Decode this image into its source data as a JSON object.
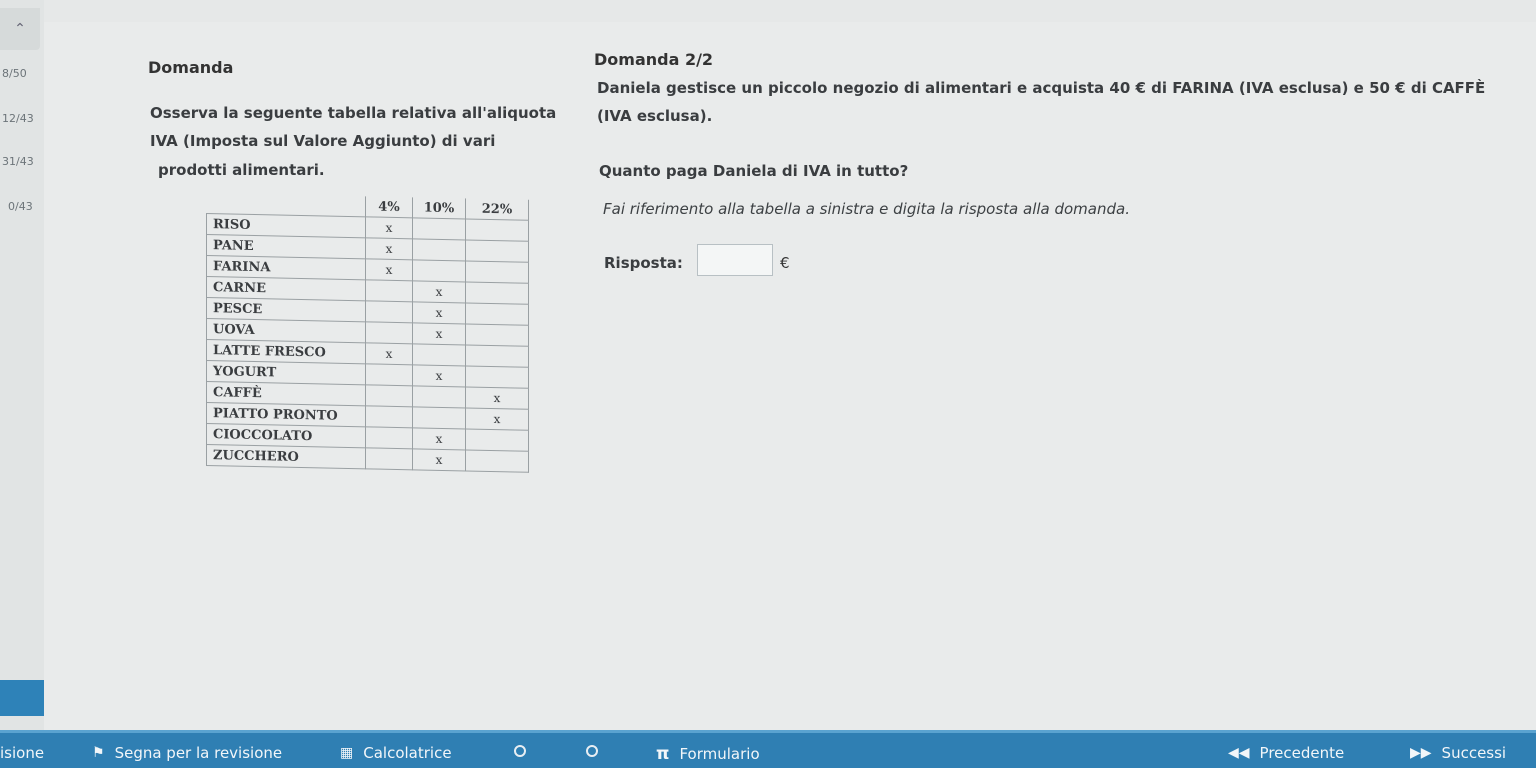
{
  "sidebar": {
    "collapse_icon": "chevron-up-icon",
    "progress": [
      "8/50",
      "12/43",
      "31/43",
      "0/43"
    ]
  },
  "left_question": {
    "header": "Domanda",
    "text_line1": "Osserva la seguente tabella relativa all'aliquota",
    "text_line2": "IVA (Imposta sul Valore Aggiunto) di vari",
    "text_line3": "prodotti alimentari.",
    "table": {
      "headers": [
        "4%",
        "10%",
        "22%"
      ],
      "rows": [
        {
          "name": "RISO",
          "marks": [
            "x",
            "",
            ""
          ]
        },
        {
          "name": "PANE",
          "marks": [
            "x",
            "",
            ""
          ]
        },
        {
          "name": "FARINA",
          "marks": [
            "x",
            "",
            ""
          ]
        },
        {
          "name": "CARNE",
          "marks": [
            "",
            "x",
            ""
          ]
        },
        {
          "name": "PESCE",
          "marks": [
            "",
            "x",
            ""
          ]
        },
        {
          "name": "UOVA",
          "marks": [
            "",
            "x",
            ""
          ]
        },
        {
          "name": "LATTE FRESCO",
          "marks": [
            "x",
            "",
            ""
          ]
        },
        {
          "name": "YOGURT",
          "marks": [
            "",
            "x",
            ""
          ]
        },
        {
          "name": "CAFFÈ",
          "marks": [
            "",
            "",
            "x"
          ]
        },
        {
          "name": "PIATTO PRONTO",
          "marks": [
            "",
            "",
            "x"
          ]
        },
        {
          "name": "CIOCCOLATO",
          "marks": [
            "",
            "x",
            ""
          ]
        },
        {
          "name": "ZUCCHERO",
          "marks": [
            "",
            "x",
            ""
          ]
        }
      ]
    }
  },
  "right_question": {
    "title": "Domanda 2/2",
    "text": "Daniela gestisce un piccolo negozio di alimentari e acquista 40 € di FARINA (IVA esclusa) e 50 € di CAFFÈ (IVA esclusa).",
    "question": "Quanto paga Daniela di IVA in tutto?",
    "hint": "Fai riferimento alla tabella a sinistra e digita la risposta alla domanda.",
    "answer_label": "Risposta:",
    "answer_value": "",
    "currency": "€"
  },
  "bottom_bar": {
    "item_left": "isione",
    "review": "Segna per la revisione",
    "calculator": "Calcolatrice",
    "formulary": "Formulario",
    "previous": "Precedente",
    "next": "Successi"
  }
}
